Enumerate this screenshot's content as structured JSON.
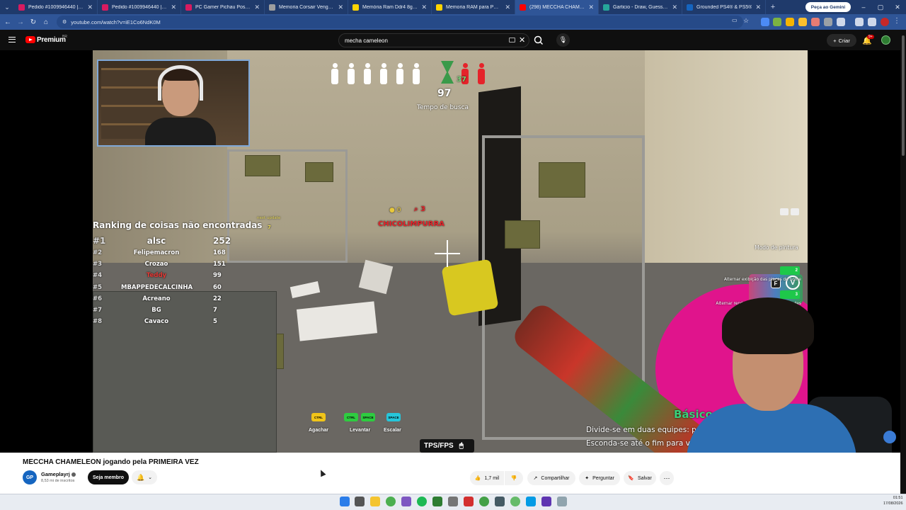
{
  "browser": {
    "tabs": [
      {
        "title": "Pedido #1009946440 | Pichau",
        "color": "#d81b60"
      },
      {
        "title": "Pedido #1009946440 | Pichau",
        "color": "#d81b60"
      },
      {
        "title": "PC Gamer Pichau Poseidon III, ...",
        "color": "#d81b60"
      },
      {
        "title": "Memoria Corsair Vengeance RGB ...",
        "color": "#9e9e9e"
      },
      {
        "title": "Memória Ram Ddr4 8gb 3600mhz ...",
        "color": "#ffd400"
      },
      {
        "title": "Memoria RAM para PC 16GB 1x16 ...",
        "color": "#ffd400"
      },
      {
        "title": "(298) MECCHA CHAMELEON jo...",
        "color": "#ff0000",
        "active": true
      },
      {
        "title": "Garticio - Draw, Guess, WIN",
        "color": "#26a69a"
      },
      {
        "title": "Grounded PS4® & PS5®",
        "color": "#1565c0"
      }
    ],
    "new_tab": "+",
    "gemini_label": "Peça ao Gemini",
    "url": "youtube.com/watch?v=iE1Co6NdK0M"
  },
  "youtube": {
    "logo_text": "Premium",
    "country_code": "BR",
    "search_value": "mecha cameleon",
    "create_label": "Criar",
    "notif_count": "9+",
    "video": {
      "hud": {
        "timer": "97",
        "timer_label": "Tempo de busca",
        "hider_count": "37",
        "hud_icon_count_left": "0",
        "hud_icon_count_right": "3",
        "player_name": "CHICOLIMPURRA",
        "ranking_title": "Ranking de coisas não encontradas",
        "next_update_label": "next update",
        "next_update_value": "7",
        "ranking": [
          {
            "pos": "#1",
            "name": "alsc",
            "pts": "252"
          },
          {
            "pos": "#2",
            "name": "Felipemacron",
            "pts": "168"
          },
          {
            "pos": "#3",
            "name": "Crozao",
            "pts": "151"
          },
          {
            "pos": "#4",
            "name": "Teddy",
            "pts": "99"
          },
          {
            "pos": "#5",
            "name": "MBAPPEDECALCINHA",
            "pts": "60"
          },
          {
            "pos": "#6",
            "name": "Acreano",
            "pts": "22"
          },
          {
            "pos": "#7",
            "name": "BG",
            "pts": "7"
          },
          {
            "pos": "#8",
            "name": "Cavaco",
            "pts": "5"
          }
        ],
        "controls": [
          {
            "key": "CTRL",
            "label": "Agachar"
          },
          {
            "key": "CTRL SPACE",
            "label": "Levantar"
          },
          {
            "key": "SPACE",
            "label": "Escalar"
          }
        ],
        "tps_fps": "TPS/FPS",
        "paint_key": "F",
        "paint_label": "Modo de pintura",
        "toggle_names_key": "2",
        "toggle_names_label": "Alternar exibição das placas de nome",
        "toggle_walls_key": "3",
        "toggle_walls_label": "Alternar renderização através de paredes",
        "mode_label": "Básico",
        "mode_desc_1": "Divide-se em duas equipes: pegad",
        "mode_desc_2": "Esconda-se até o fim para vencer"
      }
    },
    "title": "MECCHA CHAMELEON jogando pela PRIMEIRA VEZ",
    "channel": {
      "name": "Gameplayrj",
      "subs": "8,53 mi de inscritos",
      "avatar_text": "GP"
    },
    "member_label": "Seja membro",
    "actions": {
      "likes": "1,7 mil",
      "share": "Compartilhar",
      "ask": "Perguntar",
      "save": "Salvar"
    }
  },
  "taskbar": {
    "time": "01:51",
    "date": "17/08/2026"
  }
}
